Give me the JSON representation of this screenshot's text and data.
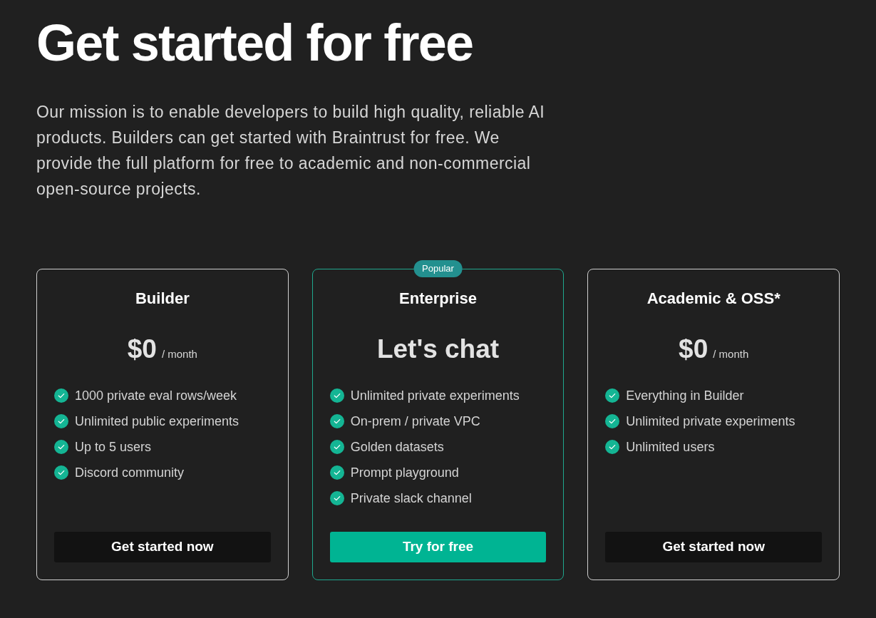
{
  "heading": "Get started for free",
  "intro": "Our mission is to enable developers to build high quality, reliable AI products. Builders can get started with Braintrust for free. We provide the full platform for free to academic and non-commercial open-source projects.",
  "plans": [
    {
      "name": "Builder",
      "highlighted": false,
      "price": "$0",
      "period": "/ month",
      "features": [
        "1000 private eval rows/week",
        "Unlimited public experiments",
        "Up to 5 users",
        "Discord community"
      ],
      "cta": {
        "label": "Get started now",
        "kind": "secondary"
      }
    },
    {
      "name": "Enterprise",
      "highlighted": true,
      "badge": "Popular",
      "price": "Let's chat",
      "features": [
        "Unlimited private experiments",
        "On-prem / private VPC",
        "Golden datasets",
        "Prompt playground",
        "Private slack channel"
      ],
      "cta": {
        "label": "Try for free",
        "kind": "primary"
      }
    },
    {
      "name": "Academic & OSS*",
      "highlighted": false,
      "price": "$0",
      "period": "/ month",
      "features": [
        "Everything in Builder",
        "Unlimited private experiments",
        "Unlimited users"
      ],
      "cta": {
        "label": "Get started now",
        "kind": "secondary"
      }
    }
  ]
}
